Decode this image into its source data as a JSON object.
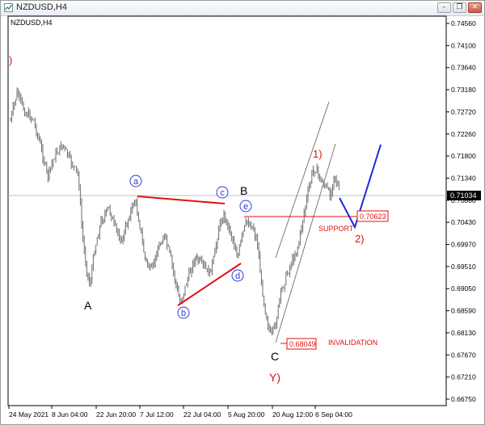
{
  "window": {
    "title": "NZDUSD,H4",
    "buttons": [
      "minimize",
      "restore",
      "close"
    ]
  },
  "chart": {
    "symbol_label": "NZDUSD,H4",
    "current_price": "0.71034",
    "price_axis": [
      "0.74560",
      "0.74100",
      "0.73640",
      "0.73180",
      "0.72720",
      "0.72260",
      "0.71800",
      "0.71340",
      "0.70880",
      "0.70430",
      "0.69970",
      "0.69510",
      "0.69050",
      "0.68590",
      "0.68130",
      "0.67670",
      "0.67210",
      "0.66750"
    ],
    "time_axis": [
      "24 May 2021",
      "8 Jun 04:00",
      "22 Jun 20:00",
      "7 Jul 12:00",
      "22 Jul 04:00",
      "5 Aug 20:00",
      "20 Aug 12:00",
      "6 Sep 04:00"
    ],
    "annotations": {
      "wave_top_left": ")",
      "wave_a_big": "A",
      "wave_b_big": "B",
      "wave_c_big": "C",
      "wave_y": "Y)",
      "sub_a": "a",
      "sub_b": "b",
      "sub_c": "c",
      "sub_d": "d",
      "sub_e": "e",
      "wave_1": "1)",
      "wave_2": "2)",
      "support_label": "SUPPORT",
      "support_price": "0.70623",
      "invalidation_label": "INVALIDATION",
      "invalidation_price": "0.68049"
    },
    "colors": {
      "candles": "#6b6b6b",
      "triangle_lines": "#e01010",
      "projection": "#1a2bd8",
      "labels_red": "#e01010",
      "labels_blue": "#2a3ad8",
      "channel": "#7a7a7a",
      "price_tag_bg": "#000000"
    }
  }
}
